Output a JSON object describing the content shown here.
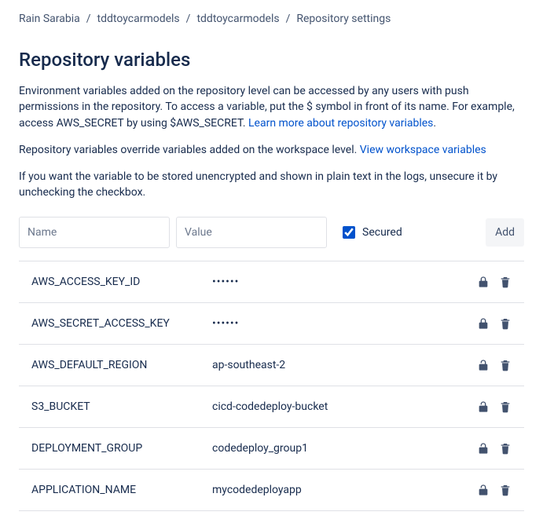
{
  "breadcrumb": {
    "items": [
      {
        "label": "Rain Sarabia"
      },
      {
        "label": "tddtoycarmodels"
      },
      {
        "label": "tddtoycarmodels"
      },
      {
        "label": "Repository settings"
      }
    ]
  },
  "page": {
    "title": "Repository variables",
    "desc1_prefix": "Environment variables added on the repository level can be accessed by any users with push permissions in the repository. To access a variable, put the $ symbol in front of its name. For example, access AWS_SECRET by using $AWS_SECRET. ",
    "desc1_link": "Learn more about repository variables",
    "desc1_suffix": ".",
    "desc2_prefix": "Repository variables override variables added on the workspace level. ",
    "desc2_link": "View workspace variables",
    "desc3": "If you want the variable to be stored unencrypted and shown in plain text in the logs, unsecure it by unchecking the checkbox."
  },
  "addRow": {
    "name_placeholder": "Name",
    "value_placeholder": "Value",
    "secured_label": "Secured",
    "add_label": "Add"
  },
  "variables": [
    {
      "name": "AWS_ACCESS_KEY_ID",
      "value": "••••••",
      "secured": true
    },
    {
      "name": "AWS_SECRET_ACCESS_KEY",
      "value": "••••••",
      "secured": true
    },
    {
      "name": "AWS_DEFAULT_REGION",
      "value": "ap-southeast-2",
      "secured": false
    },
    {
      "name": "S3_BUCKET",
      "value": "cicd-codedeploy-bucket",
      "secured": false
    },
    {
      "name": "DEPLOYMENT_GROUP",
      "value": "codedeploy_group1",
      "secured": false
    },
    {
      "name": "APPLICATION_NAME",
      "value": "mycodedeployapp",
      "secured": false
    }
  ]
}
